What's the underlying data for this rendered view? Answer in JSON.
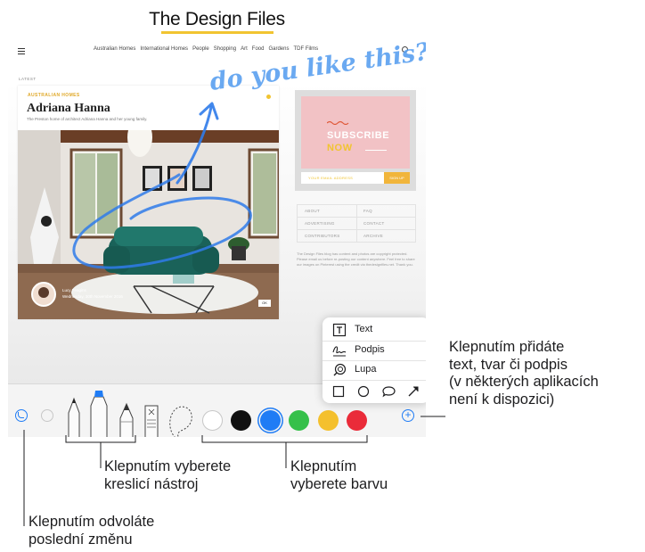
{
  "site": {
    "logo": "The Design Files",
    "nav": [
      "Australian Homes",
      "International Homes",
      "People",
      "Shopping",
      "Art",
      "Food",
      "Gardens",
      "TDF Films"
    ],
    "latest": "LATEST",
    "article": {
      "kicker": "AUSTRALIAN HOMES",
      "title": "Adriana Hanna",
      "subtitle": "The Preston home of architect Adriana Hanna and her young family.",
      "author_line1": "Lucy Feagins",
      "author_line2": "Wednesday, 30th November 2016",
      "photo_button": "OK"
    },
    "sidebar": {
      "subscribe_line1": "SUBSCRIBE",
      "subscribe_line2": "NOW",
      "email_placeholder": "YOUR EMAIL ADDRESS",
      "signup": "SIGN UP",
      "links": [
        "ABOUT",
        "FAQ",
        "ADVERTISING",
        "CONTACT",
        "CONTRIBUTORS",
        "ARCHIVE"
      ],
      "footer_text": "The Design Files blog has content and photos are copyright protected. Please email us before re-posting our content anywhere. Feel free to share our images on Pinterest using the credit via thedesignfiles.net. Thank you."
    }
  },
  "handwriting": "do you like this?",
  "toolbar": {
    "undo_icon": "undo-icon",
    "redo_icon": "redo-icon",
    "tools": [
      "pen",
      "marker",
      "pencil",
      "eraser",
      "lasso"
    ],
    "colors": [
      "#ffffff",
      "#111111",
      "#1f7cf5",
      "#35c04a",
      "#f4c02d",
      "#ea2b39"
    ],
    "selected_color": "#1f7cf5",
    "add_icon": "plus-icon"
  },
  "popup": {
    "items": [
      {
        "label": "Text",
        "icon": "text-box-icon"
      },
      {
        "label": "Podpis",
        "icon": "signature-icon"
      },
      {
        "label": "Lupa",
        "icon": "magnifier-icon"
      }
    ],
    "shapes": [
      "square-icon",
      "circle-icon",
      "speech-bubble-icon",
      "arrow-icon"
    ]
  },
  "callouts": {
    "add": [
      "Klepnutím přidáte",
      "text, tvar či podpis",
      "(v některých aplikacích",
      "není k dispozici)"
    ],
    "tool": [
      "Klepnutím vyberete",
      "kreslicí nástroj"
    ],
    "color": [
      "Klepnutím",
      "vyberete barvu"
    ],
    "undo": [
      "Klepnutím odvoláte",
      "poslední změnu"
    ]
  }
}
